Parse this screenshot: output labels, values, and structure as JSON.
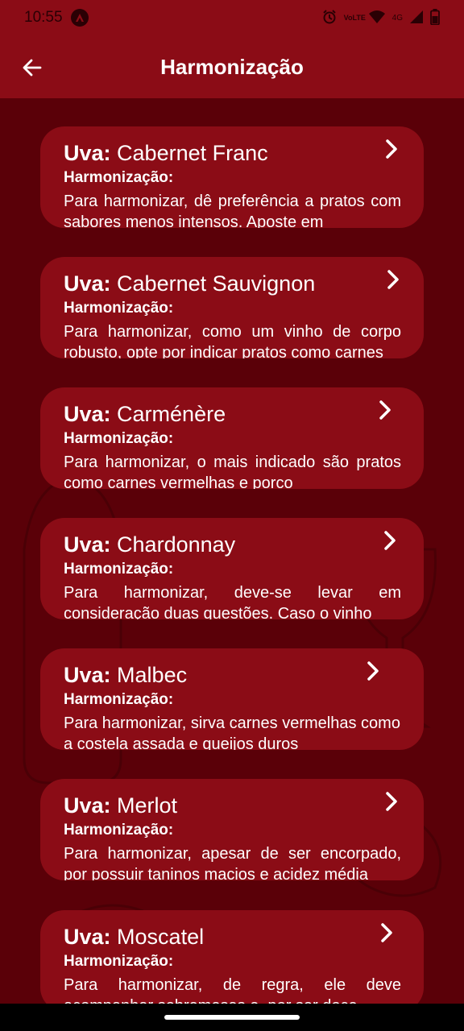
{
  "status_bar": {
    "time": "10:55",
    "network_label": "VoLTE",
    "signal_label": "4G"
  },
  "app_bar": {
    "title": "Harmonização"
  },
  "cards": [
    {
      "uva_label": "Uva:",
      "grape": "Cabernet Franc",
      "sub_label": "Harmonização:",
      "text": "Para harmonizar, dê preferência a pratos com sabores menos intensos. Aposte em"
    },
    {
      "uva_label": "Uva:",
      "grape": "Cabernet Sauvignon",
      "sub_label": "Harmonização:",
      "text": "Para harmonizar, como um vinho de corpo robusto, opte por indicar pratos como carnes"
    },
    {
      "uva_label": "Uva:",
      "grape": "Carménère",
      "sub_label": "Harmonização:",
      "text": "Para harmonizar, o mais indicado são pratos como carnes vermelhas e porco"
    },
    {
      "uva_label": "Uva:",
      "grape": "Chardonnay",
      "sub_label": "Harmonização:",
      "text": "Para harmonizar, deve-se levar em consideração duas questões. Caso o vinho"
    },
    {
      "uva_label": "Uva:",
      "grape": "Malbec",
      "sub_label": "Harmonização:",
      "text": "Para harmonizar, sirva carnes vermelhas como a costela assada e queijos duros"
    },
    {
      "uva_label": "Uva:",
      "grape": "Merlot",
      "sub_label": "Harmonização:",
      "text": "Para harmonizar, apesar de ser encorpado, por possuir taninos macios e acidez média"
    },
    {
      "uva_label": "Uva:",
      "grape": "Moscatel",
      "sub_label": "Harmonização:",
      "text": "Para harmonizar, de regra, ele deve acompanhar sobremesas e, por ser doce"
    }
  ]
}
